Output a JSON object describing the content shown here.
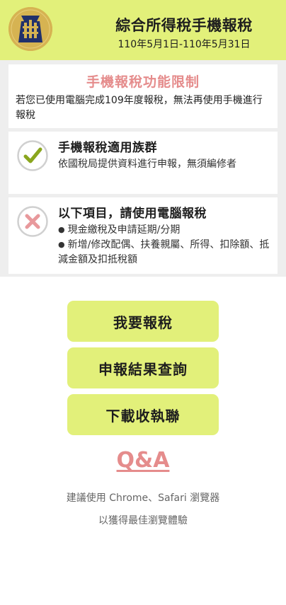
{
  "header": {
    "title": "綜合所得稅手機報稅",
    "period": "110年5月1日-110年5月31日",
    "logo_icon": "national-taxation-bureau-emblem-icon"
  },
  "notice": {
    "limit_title": "手機報稅功能限制",
    "limit_body": "若您已使用電腦完成109年度報稅，無法再使用手機進行報稅",
    "eligible": {
      "icon": "check-icon",
      "title": "手機報稅適用族群",
      "body": "依國稅局提供資料進行申報，無須編修者"
    },
    "not_eligible": {
      "icon": "cross-icon",
      "title": "以下項目，請使用電腦報稅",
      "items": [
        "現金繳稅及申請延期/分期",
        "新增/修改配偶、扶養親屬、所得、扣除額、抵減金額及扣抵稅額"
      ]
    }
  },
  "actions": {
    "file_tax": "我要報稅",
    "query_result": "申報結果查詢",
    "download_receipt": "下載收執聯",
    "qa": "Q&A"
  },
  "footer": {
    "line1": "建議使用 Chrome、Safari 瀏覽器",
    "line2": "以獲得最佳瀏覽體驗"
  },
  "colors": {
    "accent": "#e2f07a",
    "alert_pink": "#e58c8c",
    "check_green": "#8aa61e",
    "cross_pink": "#e8999c"
  }
}
